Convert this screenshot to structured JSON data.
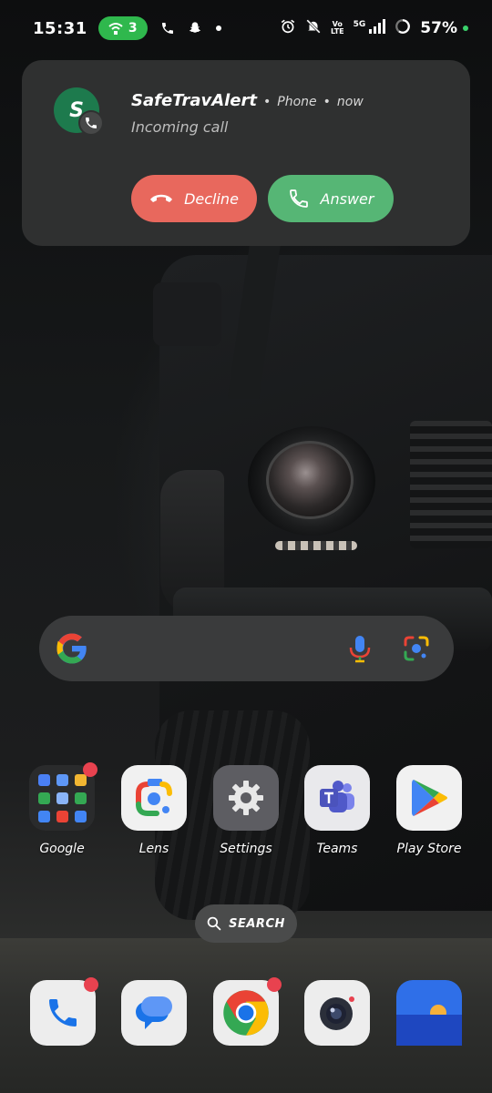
{
  "status_bar": {
    "time": "15:31",
    "hotspot_count": "3",
    "volte_line1": "Vo",
    "volte_line2": "LTE",
    "network": "5G",
    "battery": "57%"
  },
  "notification": {
    "avatar_letter": "S",
    "app_name": "SafeTravAlert",
    "source": "Phone",
    "time": "now",
    "text": "Incoming call",
    "decline_label": "Decline",
    "answer_label": "Answer",
    "colors": {
      "decline": "#e8685d",
      "answer": "#56b675",
      "avatar": "#1d7a4d"
    }
  },
  "search_bar": {
    "icons": [
      "google-g-icon",
      "microphone-icon",
      "lens-icon"
    ]
  },
  "apps": [
    {
      "label": "Google",
      "icon": "google-folder-icon",
      "badge": true
    },
    {
      "label": "Lens",
      "icon": "lens-icon",
      "badge": false
    },
    {
      "label": "Settings",
      "icon": "gear-icon",
      "badge": false
    },
    {
      "label": "Teams",
      "icon": "teams-icon",
      "badge": false
    },
    {
      "label": "Play Store",
      "icon": "play-store-icon",
      "badge": false
    }
  ],
  "drawer_search": {
    "label": "SEARCH"
  },
  "dock": [
    {
      "name": "phone",
      "icon": "phone-icon",
      "badge": true
    },
    {
      "name": "messages",
      "icon": "messages-icon",
      "badge": false
    },
    {
      "name": "chrome",
      "icon": "chrome-icon",
      "badge": true
    },
    {
      "name": "camera",
      "icon": "camera-icon",
      "badge": false
    },
    {
      "name": "gallery",
      "icon": "gallery-icon",
      "badge": false
    }
  ]
}
